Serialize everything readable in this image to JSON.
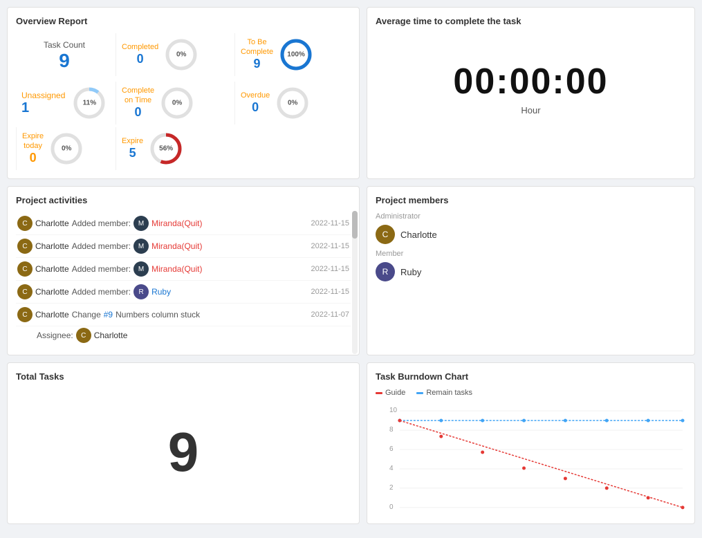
{
  "overview": {
    "title": "Overview Report",
    "taskCount": {
      "label": "Task Count",
      "value": "9"
    },
    "unassigned": {
      "label": "Unassigned",
      "value": "1",
      "percent": "11%"
    },
    "stats": [
      {
        "label": "Completed",
        "value": "0",
        "percent": "0%",
        "color": "normal"
      },
      {
        "label": "To Be\nComplete",
        "value": "9",
        "percent": "100%",
        "color": "blue-ring"
      },
      {
        "label": "Complete\non Time",
        "value": "0",
        "percent": "0%",
        "color": "normal"
      },
      {
        "label": "Overdue",
        "value": "0",
        "percent": "0%",
        "color": "normal"
      },
      {
        "label": "Expire\ntoday",
        "value": "0",
        "percent": "0%",
        "color": "normal",
        "valueColor": "orange"
      },
      {
        "label": "Expire",
        "value": "5",
        "percent": "56%",
        "color": "red-ring"
      }
    ]
  },
  "avgTime": {
    "title": "Average time to complete the task",
    "time": "00:00:00",
    "unit": "Hour"
  },
  "activities": {
    "title": "Project activities",
    "items": [
      {
        "user": "Charlotte",
        "action": "Added member:",
        "target": "Miranda(Quit)",
        "targetType": "quit",
        "date": "2022-11-15"
      },
      {
        "user": "Charlotte",
        "action": "Added member:",
        "target": "Miranda(Quit)",
        "targetType": "quit",
        "date": "2022-11-15"
      },
      {
        "user": "Charlotte",
        "action": "Added member:",
        "target": "Miranda(Quit)",
        "targetType": "quit",
        "date": "2022-11-15"
      },
      {
        "user": "Charlotte",
        "action": "Added member:",
        "target": "Ruby",
        "targetType": "ruby",
        "date": "2022-11-15"
      }
    ],
    "changeItem": {
      "user": "Charlotte",
      "action": "Change",
      "number": "#9",
      "description": "Numbers column stuck",
      "date": "2022-11-07",
      "assigneeLabel": "Assignee:",
      "assigneeName": "Charlotte"
    }
  },
  "members": {
    "title": "Project members",
    "adminLabel": "Administrator",
    "memberLabel": "Member",
    "admin": {
      "name": "Charlotte"
    },
    "member": {
      "name": "Ruby"
    }
  },
  "totalTasks": {
    "title": "Total Tasks",
    "value": "9"
  },
  "burndown": {
    "title": "Task Burndown Chart",
    "guideLegend": "Guide",
    "remainLegend": "Remain tasks",
    "yMax": 10,
    "yLabels": [
      "10",
      "8",
      "6",
      "4",
      "2",
      "0"
    ]
  }
}
